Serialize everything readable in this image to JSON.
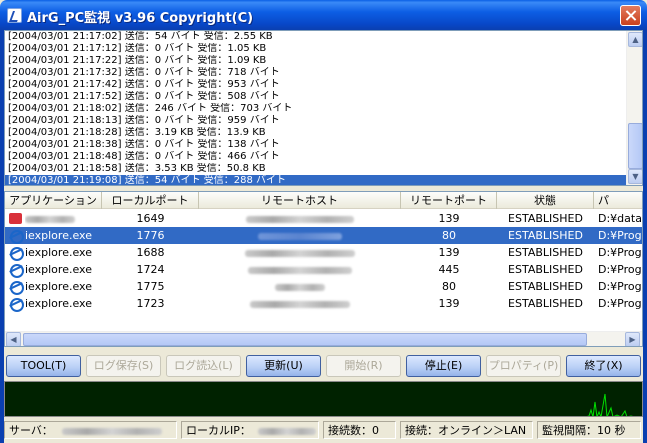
{
  "window": {
    "title": "AirG_PC監視 v3.96 Copyright(C)"
  },
  "log": {
    "lines": [
      "[2004/03/01 21:17:02]  送信：54 バイト   受信：2.55 KB",
      "[2004/03/01 21:17:12]  送信：0 バイト   受信：1.05 KB",
      "[2004/03/01 21:17:22]  送信：0 バイト   受信：1.09 KB",
      "[2004/03/01 21:17:32]  送信：0 バイト   受信：718 バイト",
      "[2004/03/01 21:17:42]  送信：0 バイト   受信：953 バイト",
      "[2004/03/01 21:17:52]  送信：0 バイト   受信：508 バイト",
      "[2004/03/01 21:18:02]  送信：246 バイト  受信：703 バイト",
      "[2004/03/01 21:18:13]  送信：0 バイト   受信：959 バイト",
      "[2004/03/01 21:18:28]  送信：3.19 KB   受信：13.9 KB",
      "[2004/03/01 21:18:38]  送信：0 バイト   受信：138 バイト",
      "[2004/03/01 21:18:48]  送信：0 バイト   受信：466 バイト",
      "[2004/03/01 21:18:58]  送信：3.53 KB   受信：50.8 KB",
      "[2004/03/01 21:19:08]  送信：54 バイト  受信：288 バイト"
    ],
    "selected_index": 12
  },
  "table": {
    "columns": [
      "アプリケーション",
      "ローカルポート",
      "リモートホスト",
      "リモートポート",
      "状態",
      "パ"
    ],
    "rows": [
      {
        "app": "",
        "local_port": "1649",
        "remote_port": "139",
        "state": "ESTABLISHED",
        "path": "D:¥data¥r",
        "icon": "red-app-icon",
        "selected": false
      },
      {
        "app": "iexplore.exe",
        "local_port": "1776",
        "remote_port": "80",
        "state": "ESTABLISHED",
        "path": "D:¥Progra",
        "icon": "ie-icon",
        "selected": true
      },
      {
        "app": "iexplore.exe",
        "local_port": "1688",
        "remote_port": "139",
        "state": "ESTABLISHED",
        "path": "D:¥Progra",
        "icon": "ie-icon",
        "selected": false
      },
      {
        "app": "iexplore.exe",
        "local_port": "1724",
        "remote_port": "445",
        "state": "ESTABLISHED",
        "path": "D:¥Progra",
        "icon": "ie-icon",
        "selected": false
      },
      {
        "app": "iexplore.exe",
        "local_port": "1775",
        "remote_port": "80",
        "state": "ESTABLISHED",
        "path": "D:¥Progra",
        "icon": "ie-icon",
        "selected": false
      },
      {
        "app": "iexplore.exe",
        "local_port": "1723",
        "remote_port": "139",
        "state": "ESTABLISHED",
        "path": "D:¥Progra",
        "icon": "ie-icon",
        "selected": false
      }
    ]
  },
  "buttons": {
    "tool": "TOOL(T)",
    "log_save": "ログ保存(S)",
    "log_load": "ログ読込(L)",
    "update": "更新(U)",
    "start": "開始(R)",
    "stop": "停止(E)",
    "properties": "プロパティ(P)",
    "exit": "終了(X)"
  },
  "statusbar": {
    "server": "サーバ：",
    "local_ip": "ローカルIP：",
    "connections": "接続数：0",
    "connection": "接続：オンライン＞LAN",
    "interval": "監視間隔：10 秒"
  },
  "colors": {
    "selection": "#316ac5",
    "graph_bg": "#002200",
    "graph_line": "#00e000"
  }
}
